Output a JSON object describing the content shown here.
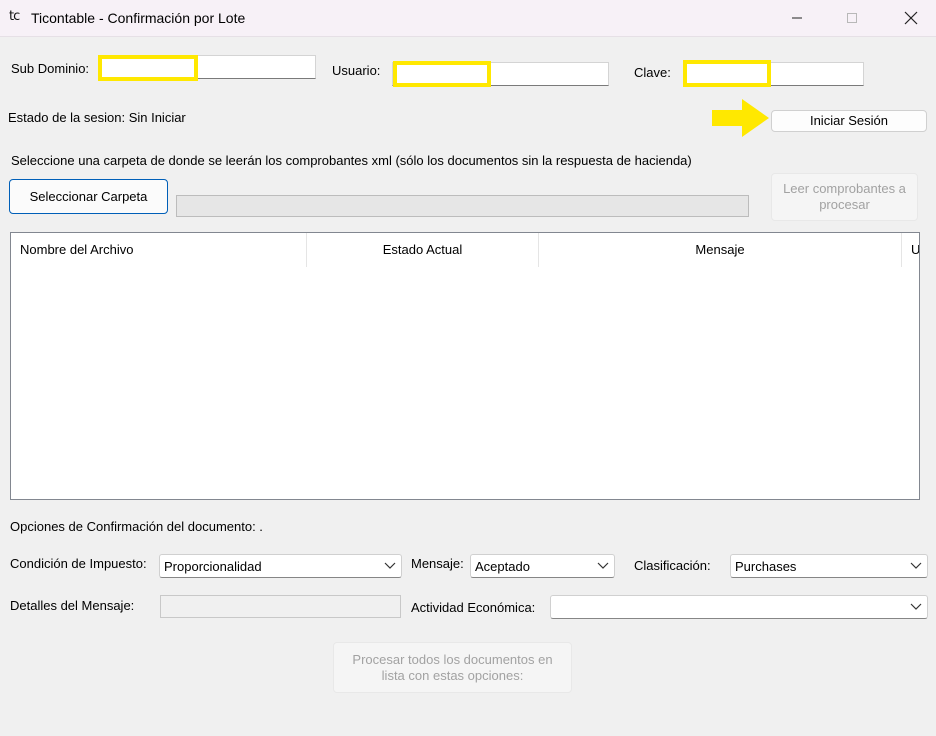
{
  "window": {
    "icon_text": "tc",
    "title": "Ticontable - Confirmación por Lote",
    "minimize_icon": "minimize-icon",
    "maximize_icon": "maximize-icon",
    "close_icon": "close-icon"
  },
  "login": {
    "subdominio_label": "Sub Dominio:",
    "subdominio_value": "",
    "usuario_label": "Usuario:",
    "usuario_value": "",
    "clave_label": "Clave:",
    "clave_value": "",
    "estado_label": "Estado de la sesion: Sin Iniciar",
    "iniciar_label": "Iniciar Sesión",
    "highlight_color": "#ffe800"
  },
  "folder": {
    "instruction": "Seleccione una carpeta de donde se leerán los comprobantes xml (sólo los documentos sin la respuesta de hacienda)",
    "select_label": "Seleccionar Carpeta",
    "read_label": "Leer comprobantes a procesar"
  },
  "table": {
    "columns": [
      "Nombre del Archivo",
      "Estado Actual",
      "Mensaje",
      "U"
    ],
    "rows": []
  },
  "options": {
    "heading": "Opciones de Confirmación del documento: .",
    "condicion_label": "Condición de Impuesto:",
    "condicion_value": "Proporcionalidad",
    "mensaje_label": "Mensaje:",
    "mensaje_value": "Aceptado",
    "clasificacion_label": "Clasificación:",
    "clasificacion_value": "Purchases",
    "detalles_label": "Detalles del Mensaje:",
    "detalles_value": "",
    "actividad_label": "Actividad Económica:",
    "actividad_value": "",
    "procesar_label": "Procesar todos los documentos en lista con estas opciones:"
  },
  "colors": {
    "accent": "#005fb8",
    "arrow": "#ffe800",
    "disabled_text": "#a2a2a2"
  }
}
